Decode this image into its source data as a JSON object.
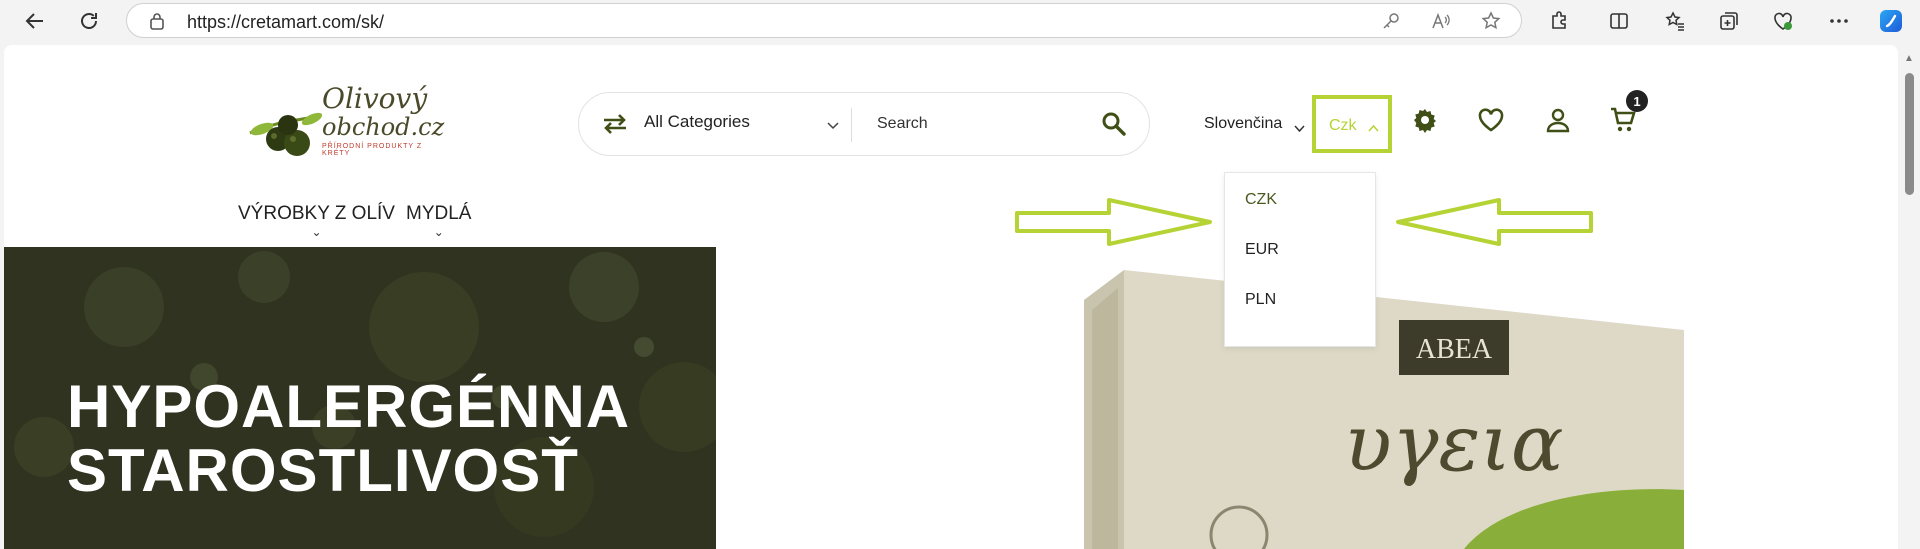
{
  "browser": {
    "url": "https://cretamart.com/sk/"
  },
  "header": {
    "logo_text_line1": "Olivový",
    "logo_text_line2": "obchod.cz",
    "logo_tagline": "PŘÍRODNÍ PRODUKTY Z KRÉTY",
    "category_label": "All Categories",
    "search_placeholder": "Search",
    "language": "Slovenčina",
    "currency": "Czk",
    "cart_count": "1"
  },
  "currency_dropdown": {
    "options": [
      "CZK",
      "EUR",
      "PLN"
    ],
    "selected": "CZK"
  },
  "nav": {
    "items": [
      "VÝROBKY Z OLÍV",
      "MYDLÁ"
    ]
  },
  "hero": {
    "line1": "HYPOALERGÉNNA",
    "line2": "STAROSTLIVOSŤ"
  },
  "product_box": {
    "brand": "ABEA",
    "name": "υγεια"
  },
  "colors": {
    "accent": "#b5d335",
    "brand_green": "#4a5a1e",
    "hero_bg": "#2f3320"
  }
}
